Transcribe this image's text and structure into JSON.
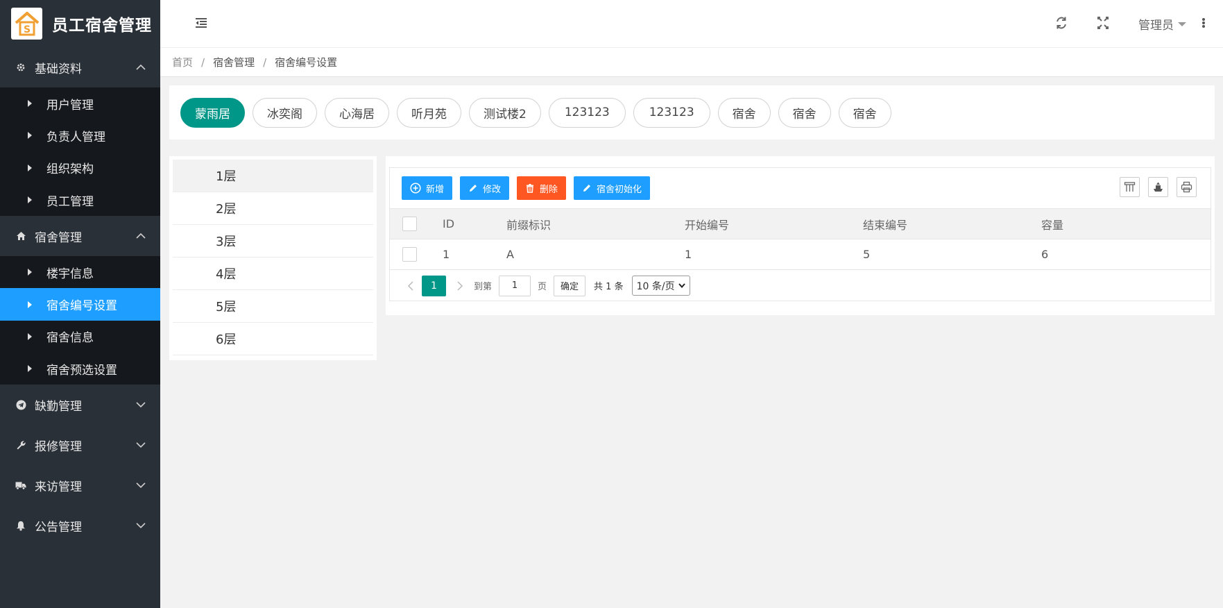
{
  "app": {
    "title": "员工宿舍管理"
  },
  "sidebar": {
    "groups": [
      {
        "label": "基础资料",
        "items": [
          "用户管理",
          "负责人管理",
          "组织架构",
          "员工管理"
        ]
      },
      {
        "label": "宿舍管理",
        "items": [
          "楼宇信息",
          "宿舍编号设置",
          "宿舍信息",
          "宿舍预选设置"
        ]
      },
      {
        "label": "缺勤管理"
      },
      {
        "label": "报修管理"
      },
      {
        "label": "来访管理"
      },
      {
        "label": "公告管理"
      }
    ],
    "active_item": "宿舍编号设置"
  },
  "header": {
    "user": "管理员"
  },
  "breadcrumb": [
    "首页",
    "宿舍管理",
    "宿舍编号设置"
  ],
  "buildings": [
    "蒙雨居",
    "冰奕阁",
    "心海居",
    "听月苑",
    "测试楼2",
    "123123",
    "123123",
    "宿舍",
    "宿舍",
    "宿舍"
  ],
  "floors": [
    "1层",
    "2层",
    "3层",
    "4层",
    "5层",
    "6层"
  ],
  "toolbar": {
    "add": "新增",
    "edit": "修改",
    "delete": "删除",
    "init": "宿舍初始化"
  },
  "table": {
    "columns": [
      "ID",
      "前缀标识",
      "开始编号",
      "结束编号",
      "容量"
    ],
    "rows": [
      [
        "1",
        "A",
        "1",
        "5",
        "6"
      ]
    ]
  },
  "pager": {
    "current": "1",
    "goto_label": "到第",
    "goto_value": "1",
    "page_unit": "页",
    "confirm": "确定",
    "total": "共 1 条",
    "page_size": "10 条/页"
  },
  "colors": {
    "accent": "#009688",
    "primary": "#1e9fff",
    "danger": "#ff5722",
    "sidebar": "#2a3038"
  }
}
